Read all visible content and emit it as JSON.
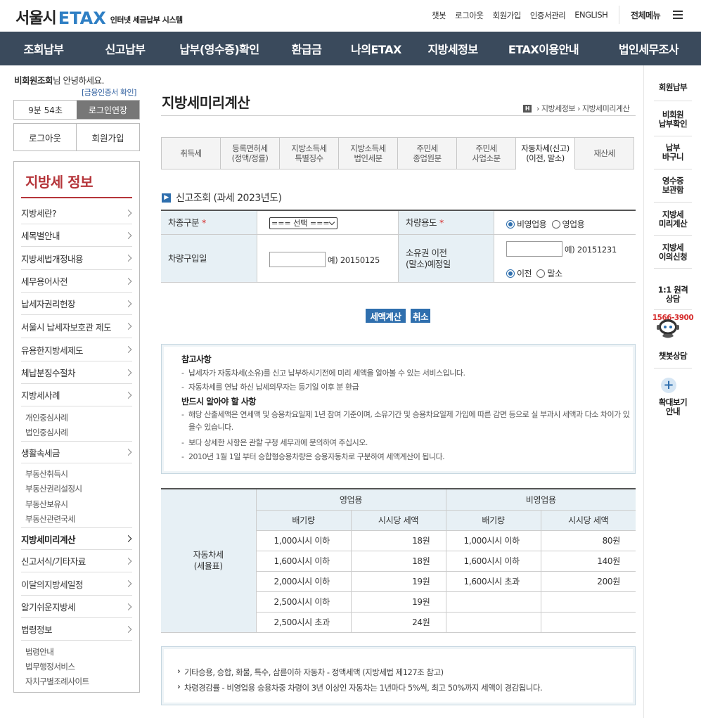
{
  "header": {
    "logo_city": "서울시",
    "logo_etax": "ETAX",
    "logo_sub": "인터넷 세금납부 시스템",
    "links": [
      "챗봇",
      "로그아웃",
      "회원가입",
      "인증서관리",
      "ENGLISH"
    ],
    "all_menu": "전체메뉴"
  },
  "gnb": [
    "조회납부",
    "신고납부",
    "납부(영수증)확인",
    "환급금",
    "나의ETAX",
    "지방세정보",
    "ETAX이용안내",
    "법인세무조사"
  ],
  "sidebar": {
    "greeting_name": "비회원조회",
    "greeting_suffix": "님 안녕하세요.",
    "cert_link": "[금융인증서 확인]",
    "timer": "9분 54초",
    "extend": "로그인연장",
    "logout": "로그아웃",
    "join": "회원가입",
    "title": "지방세 정보",
    "items": [
      {
        "label": "지방세란?"
      },
      {
        "label": "세목별안내"
      },
      {
        "label": "지방세법개정내용"
      },
      {
        "label": "세무용어사전"
      },
      {
        "label": "납세자권리헌장"
      },
      {
        "label": "서울시 납세자보호관 제도"
      },
      {
        "label": "유용한지방세제도"
      },
      {
        "label": "체납분징수절차"
      },
      {
        "label": "지방세사례"
      },
      {
        "label": "생활속세금"
      },
      {
        "label": "지방세미리계산"
      },
      {
        "label": "신고서식/기타자료"
      },
      {
        "label": "이달의지방세일정"
      },
      {
        "label": "알기쉬운지방세"
      },
      {
        "label": "법령정보"
      }
    ],
    "sub_cases": [
      "개인중심사례",
      "법인중심사례"
    ],
    "sub_life": [
      "부동산취득시",
      "부동산권리설정시",
      "부동산보유시",
      "부동산관련국세"
    ],
    "sub_law": [
      "법령안내",
      "법무행정서비스",
      "자치구별조례사이트"
    ]
  },
  "quick": {
    "items": [
      "회원납부",
      "비회원\n납부확인",
      "납부\n바구니",
      "영수증\n보관함",
      "지방세\n미리계산",
      "지방세\n이의신청"
    ],
    "consult": "1:1 원격\n상담",
    "phone": "1566-3900",
    "chatbot": "챗봇상담",
    "zoom": "확대보기\n안내"
  },
  "main": {
    "title": "지방세미리계산",
    "breadcrumb_home": "H",
    "breadcrumb": [
      "지방세정보",
      "지방세미리계산"
    ],
    "tabs": [
      "취득세",
      "등록면허세\n(정액/정률)",
      "지방소득세\n특별징수",
      "지방소득세\n법인세분",
      "주민세\n종업원분",
      "주민세\n사업소분",
      "자동차세(신고)\n(이전, 말소)",
      "재산세"
    ],
    "section": "신고조회 (과세 2023년도)",
    "form": {
      "car_type_label": "차종구분",
      "car_type_value": "=== 선택 ===",
      "use_label": "차량용도",
      "use_options": [
        "비영업용",
        "영업용"
      ],
      "purchase_label": "차량구입일",
      "purchase_example": "예) 20150125",
      "transfer_label": "소유권 이전\n(말소)예정일",
      "transfer_example": "예) 20151231",
      "transfer_options": [
        "이전",
        "말소"
      ],
      "required_mark": "*"
    },
    "buttons": {
      "calc": "세액계산",
      "cancel": "취소"
    },
    "notice": {
      "h1": "참고사항",
      "items1": [
        "납세자가 자동차세(소유)를 신고 납부하시기전에 미리 세액을 알아볼 수 있는 서비스입니다.",
        "자동차세를 연납 하신 납세의무자는 등기일 이후 분 환급"
      ],
      "h2": "반드시 알아야 할 사항",
      "items2": [
        "해당 산출세액은 연세액 및 승용차요일제 1년 참여 기준이며, 소유기간 및 승용차요일제 가입에 따른 감면 등으로 실 부과시 세액과 다소 차이가 있을수 있습니다.",
        "보다 상세한 사항은 관할 구청 세무과에 문의하여 주십시오.",
        "2010년 1월 1일 부터 승합형승용차량은 승용자동차로 구분하여 세액계산이 됩니다."
      ]
    },
    "rate_table": {
      "row_header": "자동차세\n(세율표)",
      "business": "영업용",
      "non_business": "비영업용",
      "col_cc": "배기량",
      "col_tax": "시시당 세액",
      "business_rows": [
        {
          "cc": "1,000시시 이하",
          "tax": "18원"
        },
        {
          "cc": "1,600시시 이하",
          "tax": "18원"
        },
        {
          "cc": "2,000시시 이하",
          "tax": "19원"
        },
        {
          "cc": "2,500시시 이하",
          "tax": "19원"
        },
        {
          "cc": "2,500시시 초과",
          "tax": "24원"
        }
      ],
      "non_business_rows": [
        {
          "cc": "1,000시시 이하",
          "tax": "80원"
        },
        {
          "cc": "1,600시시 이하",
          "tax": "140원"
        },
        {
          "cc": "1,600시시 초과",
          "tax": "200원"
        },
        {
          "cc": "",
          "tax": ""
        },
        {
          "cc": "",
          "tax": ""
        }
      ]
    },
    "footnotes": [
      "기타승용, 승합, 화물, 특수, 삼륜이하 자동차 - 정액세액 (지방세법 제127조 참고)",
      "차령경감률 - 비영업용 승용차중 차령이 3년 이상인 자동차는 1년마다 5%씩, 최고 50%까지 세액이 경감됩니다."
    ]
  }
}
